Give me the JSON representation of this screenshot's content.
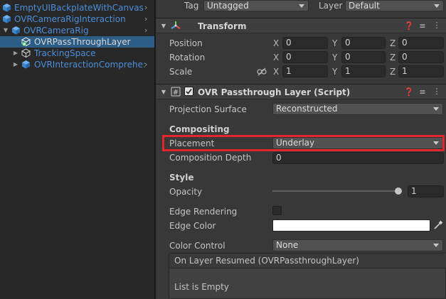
{
  "hierarchy": {
    "items": [
      {
        "label": "EmptyUIBackplateWithCanvas"
      },
      {
        "label": "OVRCameraRigInteraction"
      },
      {
        "label": "OVRCameraRig"
      },
      {
        "label": "OVRPassThroughLayer"
      },
      {
        "label": "TrackingSpace"
      },
      {
        "label": "OVRInteractionComprehe:"
      }
    ]
  },
  "object_header": {
    "tag_label": "Tag",
    "tag_value": "Untagged",
    "layer_label": "Layer",
    "layer_value": "Default"
  },
  "transform": {
    "title": "Transform",
    "rows": [
      {
        "label": "Position",
        "x": "0",
        "y": "0",
        "z": "0"
      },
      {
        "label": "Rotation",
        "x": "0",
        "y": "0",
        "z": "0"
      },
      {
        "label": "Scale",
        "x": "1",
        "y": "1",
        "z": "1"
      }
    ],
    "axis_x": "X",
    "axis_y": "Y",
    "axis_z": "Z"
  },
  "passthrough": {
    "title": "OVR Passthrough Layer (Script)",
    "projection_surface_label": "Projection Surface",
    "projection_surface_value": "Reconstructed",
    "compositing_header": "Compositing",
    "placement_label": "Placement",
    "placement_value": "Underlay",
    "composition_depth_label": "Composition Depth",
    "composition_depth_value": "0",
    "style_header": "Style",
    "opacity_label": "Opacity",
    "opacity_value": "1",
    "opacity_level": 1.0,
    "edge_rendering_label": "Edge Rendering",
    "edge_color_label": "Edge Color",
    "edge_color": "#ffffff",
    "color_control_label": "Color Control",
    "color_control_value": "None",
    "event_title": "On Layer Resumed (OVRPassthroughLayer)",
    "list_empty": "List is Empty"
  },
  "colors": {
    "hierarchy_bg": "#282828",
    "inspector_bg": "#383838",
    "selection": "#2c5d87",
    "prefab_blue": "#4c8ed9",
    "highlight_red": "#e3262d"
  }
}
